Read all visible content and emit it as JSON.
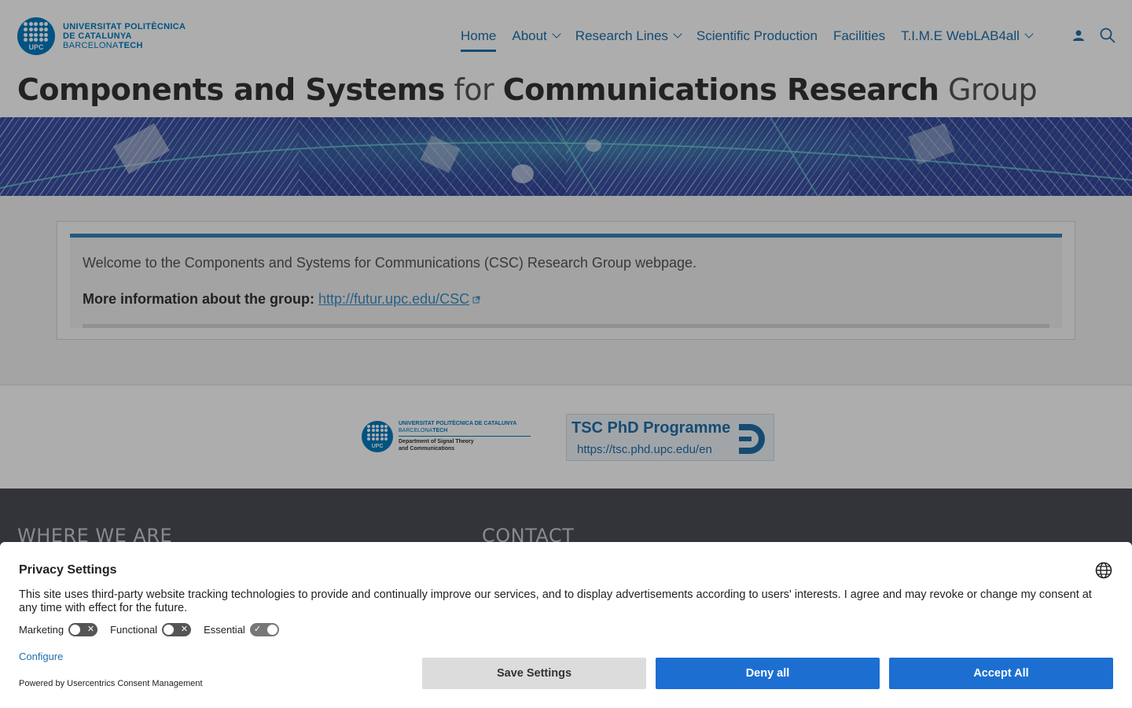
{
  "logo": {
    "line1": "UNIVERSITAT POLITÈCNICA",
    "line2": "DE CATALUNYA",
    "line3a": "BARCELONA",
    "line3b": "TECH",
    "badge": "UPC"
  },
  "nav": {
    "items": [
      {
        "label": "Home",
        "active": true
      },
      {
        "label": "About"
      },
      {
        "label": "Research Lines"
      },
      {
        "label": "Scientific Production"
      },
      {
        "label": "Facilities"
      },
      {
        "label": "T.I.M.E WebLAB4all"
      }
    ]
  },
  "title": {
    "part1": "Components and Systems",
    "part2": "for",
    "part3": "Communications Research",
    "part4": "Group"
  },
  "content": {
    "welcome": "Welcome to the Components and Systems for Communications (CSC) Research Group webpage.",
    "more_label": "More information about the group:",
    "more_link": "http://futur.upc.edu/CSC"
  },
  "partners": {
    "dept_line1": "UNIVERSITAT POLITÈCNICA DE CATALUNYA",
    "dept_line2a": "BARCELONA",
    "dept_line2b": "TECH",
    "dept_line3": "Department of Signal Theory",
    "dept_line4": "and Communications",
    "phd_title": "TSC PhD Programme",
    "phd_url": "https://tsc.phd.upc.edu/en"
  },
  "footer": {
    "where": "WHERE WE ARE",
    "contact": "CONTACT"
  },
  "consent": {
    "title": "Privacy Settings",
    "text": "This site uses third-party website tracking technologies to provide and continually improve our services, and to display advertisements according to users' interests. I agree and may revoke or change my consent at any time with effect for the future.",
    "toggles": [
      {
        "label": "Marketing",
        "on": false
      },
      {
        "label": "Functional",
        "on": false
      },
      {
        "label": "Essential",
        "on": true
      }
    ],
    "configure": "Configure",
    "powered": "Powered by Usercentrics Consent Management",
    "save": "Save Settings",
    "deny": "Deny all",
    "accept": "Accept All"
  },
  "colors": {
    "accent": "#1f6fa8",
    "button_blue": "#1c6fd1",
    "footer_bg": "#4a4d55"
  }
}
